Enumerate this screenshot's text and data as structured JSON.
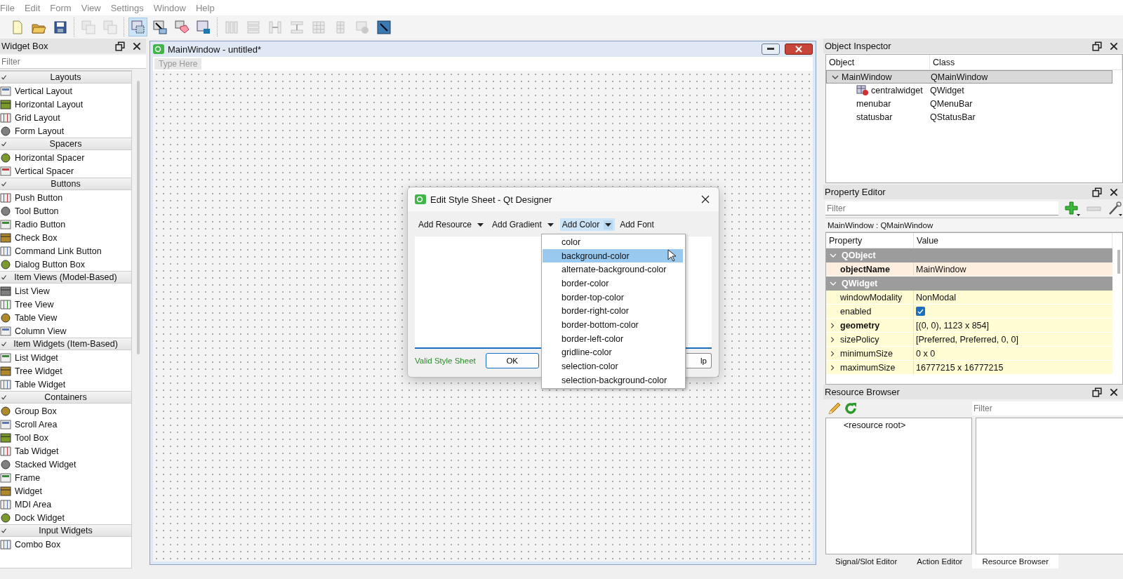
{
  "menu": [
    "File",
    "Edit",
    "Form",
    "View",
    "Settings",
    "Window",
    "Help"
  ],
  "toolbar_groups": [
    {
      "items": [
        {
          "kind": "new",
          "selected": false,
          "disabled": false
        },
        {
          "kind": "open",
          "selected": false,
          "disabled": false
        },
        {
          "kind": "save",
          "selected": false,
          "disabled": false
        }
      ]
    },
    {
      "items": [
        {
          "kind": "copy",
          "selected": false,
          "disabled": true
        },
        {
          "kind": "copy",
          "selected": false,
          "disabled": true
        }
      ]
    },
    {
      "items": [
        {
          "kind": "edit-widgets",
          "selected": true,
          "disabled": false
        },
        {
          "kind": "signals",
          "selected": false,
          "disabled": false
        },
        {
          "kind": "buddies",
          "selected": false,
          "disabled": false
        },
        {
          "kind": "taborder",
          "selected": false,
          "disabled": false
        }
      ]
    },
    {
      "items": [
        {
          "kind": "hlayout",
          "selected": false,
          "disabled": true
        },
        {
          "kind": "vlayout",
          "selected": false,
          "disabled": true
        },
        {
          "kind": "hsplit",
          "selected": false,
          "disabled": true
        },
        {
          "kind": "vsplit",
          "selected": false,
          "disabled": true
        },
        {
          "kind": "grid",
          "selected": false,
          "disabled": true
        },
        {
          "kind": "form",
          "selected": false,
          "disabled": true
        },
        {
          "kind": "break",
          "selected": false,
          "disabled": true
        },
        {
          "kind": "adjust",
          "selected": false,
          "disabled": false
        }
      ]
    }
  ],
  "widget_box": {
    "title": "Widget Box",
    "filter_placeholder": "Filter",
    "categories": [
      {
        "name": "Layouts",
        "expanded": true,
        "items": [
          "Vertical Layout",
          "Horizontal Layout",
          "Grid Layout",
          "Form Layout"
        ]
      },
      {
        "name": "Spacers",
        "expanded": true,
        "items": [
          "Horizontal Spacer",
          "Vertical Spacer"
        ]
      },
      {
        "name": "Buttons",
        "expanded": true,
        "items": [
          "Push Button",
          "Tool Button",
          "Radio Button",
          "Check Box",
          "Command Link Button",
          "Dialog Button Box"
        ]
      },
      {
        "name": "Item Views (Model-Based)",
        "expanded": true,
        "items": [
          "List View",
          "Tree View",
          "Table View",
          "Column View"
        ]
      },
      {
        "name": "Item Widgets (Item-Based)",
        "expanded": true,
        "items": [
          "List Widget",
          "Tree Widget",
          "Table Widget"
        ]
      },
      {
        "name": "Containers",
        "expanded": true,
        "items": [
          "Group Box",
          "Scroll Area",
          "Tool Box",
          "Tab Widget",
          "Stacked Widget",
          "Frame",
          "Widget",
          "MDI Area",
          "Dock Widget"
        ]
      },
      {
        "name": "Input Widgets",
        "expanded": true,
        "items": [
          "Combo Box"
        ]
      }
    ]
  },
  "form_window": {
    "title": "MainWindow - untitled*",
    "menu_placeholder": "Type Here"
  },
  "dialog": {
    "title": "Edit Style Sheet - Qt Designer",
    "tools": [
      {
        "label": "Add Resource",
        "kind": "menu",
        "open": false
      },
      {
        "label": "Add Gradient",
        "kind": "menu",
        "open": false
      },
      {
        "label": "Add Color",
        "kind": "menu",
        "open": true
      },
      {
        "label": "Add Font",
        "kind": "plain",
        "open": false
      }
    ],
    "status": "Valid Style Sheet",
    "buttons": [
      "OK",
      "lp"
    ],
    "menu_items": [
      {
        "label": "color",
        "selected": false
      },
      {
        "label": "background-color",
        "selected": true
      },
      {
        "label": "alternate-background-color",
        "selected": false
      },
      {
        "label": "border-color",
        "selected": false
      },
      {
        "label": "border-top-color",
        "selected": false
      },
      {
        "label": "border-right-color",
        "selected": false
      },
      {
        "label": "border-bottom-color",
        "selected": false
      },
      {
        "label": "border-left-color",
        "selected": false
      },
      {
        "label": "gridline-color",
        "selected": false
      },
      {
        "label": "selection-color",
        "selected": false
      },
      {
        "label": "selection-background-color",
        "selected": false
      }
    ]
  },
  "object_inspector": {
    "title": "Object Inspector",
    "columns": [
      "Object",
      "Class"
    ],
    "tree": [
      {
        "name": "MainWindow",
        "class": "QMainWindow",
        "kind": "plain",
        "selected": true,
        "expanded": true,
        "children": [
          {
            "name": "centralwidget",
            "class": "QWidget",
            "kind": "container",
            "selected": false
          },
          {
            "name": "menubar",
            "class": "QMenuBar",
            "kind": "plain",
            "selected": false
          },
          {
            "name": "statusbar",
            "class": "QStatusBar",
            "kind": "plain",
            "selected": false
          }
        ]
      }
    ]
  },
  "property_editor": {
    "title": "Property Editor",
    "filter_placeholder": "Filter",
    "context": "MainWindow : QMainWindow",
    "columns": [
      "Property",
      "Value"
    ],
    "groups": [
      {
        "name": "QObject",
        "expanded": true,
        "color": "#fdeee0",
        "rows": [
          {
            "name": "objectName",
            "value": "MainWindow",
            "kind": "text",
            "modified": true,
            "expandable": false
          }
        ]
      },
      {
        "name": "QWidget",
        "expanded": true,
        "color": "#fffbd2",
        "rows": [
          {
            "name": "windowModality",
            "value": "NonModal",
            "kind": "text",
            "modified": false,
            "expandable": false
          },
          {
            "name": "enabled",
            "kind": "checkbox",
            "checked": true,
            "modified": false,
            "expandable": false
          },
          {
            "name": "geometry",
            "value": "[(0, 0), 1123 x 854]",
            "kind": "text",
            "modified": true,
            "expandable": true
          },
          {
            "name": "sizePolicy",
            "value": "[Preferred, Preferred, 0, 0]",
            "kind": "text",
            "modified": false,
            "expandable": true
          },
          {
            "name": "minimumSize",
            "value": "0 x 0",
            "kind": "text",
            "modified": false,
            "expandable": true
          },
          {
            "name": "maximumSize",
            "value": "16777215 x 16777215",
            "kind": "text",
            "modified": false,
            "expandable": true
          }
        ]
      }
    ]
  },
  "resource_browser": {
    "title": "Resource Browser",
    "filter_placeholder": "Filter",
    "tree": [
      "<resource root>"
    ]
  },
  "bottom_tabs": [
    {
      "label": "Signal/Slot Editor",
      "selected": false
    },
    {
      "label": "Action Editor",
      "selected": false
    },
    {
      "label": "Resource Browser",
      "selected": true
    }
  ]
}
